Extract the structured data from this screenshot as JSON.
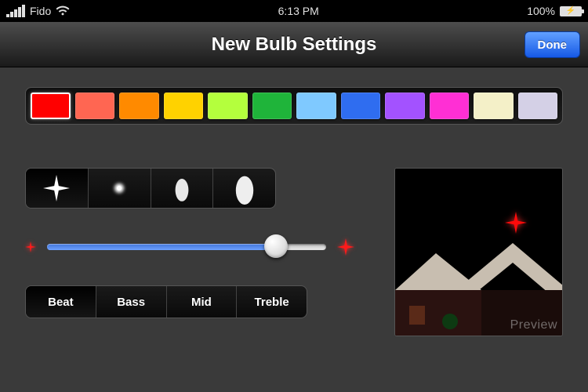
{
  "status": {
    "carrier": "Fido",
    "time": "6:13 PM",
    "battery_pct": "100%"
  },
  "nav": {
    "title": "New Bulb Settings",
    "done": "Done"
  },
  "color_row": {
    "swatches": [
      {
        "hex": "#ff0000",
        "selected": true
      },
      {
        "hex": "#ff6652",
        "selected": false
      },
      {
        "hex": "#ff8a00",
        "selected": false
      },
      {
        "hex": "#ffd200",
        "selected": false
      },
      {
        "hex": "#b4ff3d",
        "selected": false
      },
      {
        "hex": "#1fb43a",
        "selected": false
      },
      {
        "hex": "#7fc9ff",
        "selected": false
      },
      {
        "hex": "#2f6df0",
        "selected": false
      },
      {
        "hex": "#a352ff",
        "selected": false
      },
      {
        "hex": "#ff2fd4",
        "selected": false
      },
      {
        "hex": "#f4f0c8",
        "selected": false
      },
      {
        "hex": "#d4d0e6",
        "selected": false
      }
    ]
  },
  "shapes": [
    {
      "name": "four-point",
      "selected": true
    },
    {
      "name": "glow",
      "selected": false
    },
    {
      "name": "small-bulb",
      "selected": false
    },
    {
      "name": "large-bulb",
      "selected": false
    }
  ],
  "slider": {
    "value": 0.82
  },
  "segments": {
    "items": [
      {
        "label": "Beat",
        "selected": true
      },
      {
        "label": "Bass",
        "selected": false
      },
      {
        "label": "Mid",
        "selected": false
      },
      {
        "label": "Treble",
        "selected": false
      }
    ]
  },
  "preview": {
    "label": "Preview"
  }
}
